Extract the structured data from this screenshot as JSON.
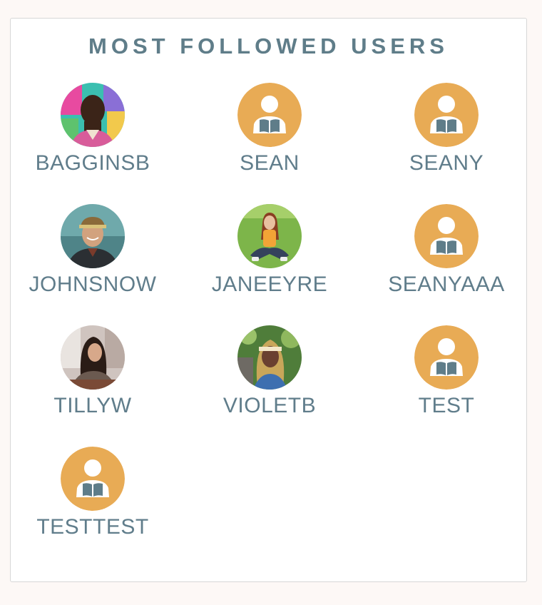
{
  "widget": {
    "title": "MOST FOLLOWED USERS"
  },
  "users": [
    {
      "name": "BAGGINSB",
      "avatar": "photo-man-graffiti-icon"
    },
    {
      "name": "SEAN",
      "avatar": "default-reader-avatar-icon"
    },
    {
      "name": "SEANY",
      "avatar": "default-reader-avatar-icon"
    },
    {
      "name": "JOHNSNOW",
      "avatar": "photo-man-cap-icon"
    },
    {
      "name": "JANEEYRE",
      "avatar": "photo-woman-grass-icon"
    },
    {
      "name": "SEANYAAA",
      "avatar": "default-reader-avatar-icon"
    },
    {
      "name": "TILLYW",
      "avatar": "photo-woman-window-icon"
    },
    {
      "name": "VIOLETB",
      "avatar": "photo-woman-braids-icon"
    },
    {
      "name": "TEST",
      "avatar": "default-reader-avatar-icon"
    },
    {
      "name": "TESTTEST",
      "avatar": "default-reader-avatar-icon"
    }
  ],
  "colors": {
    "accent": "#e8ab55",
    "text": "#607d8b",
    "border": "#d7d7d7"
  }
}
